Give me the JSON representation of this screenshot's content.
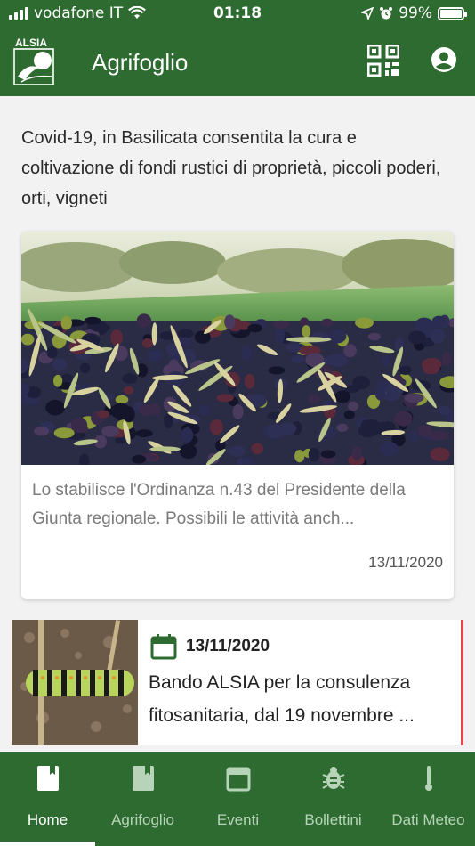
{
  "status_bar": {
    "carrier": "vodafone IT",
    "time": "01:18",
    "battery": "99%",
    "battery_level": 0.99
  },
  "app_bar": {
    "logo_text": "ALSIA",
    "title": "Agrifoglio",
    "qr_icon": "qr-code-icon",
    "account_icon": "account-circle-icon"
  },
  "featured": {
    "headline": "Covid-19, in Basilicata consentita la cura e coltivazione di fondi rustici di proprietà, piccoli poderi, orti, vigneti",
    "excerpt": "Lo stabilisce l'Ordinanza n.43 del Presidente della Giunta regionale. Possibili le attività anch...",
    "date": "13/11/2020"
  },
  "event": {
    "date": "13/11/2020",
    "title": "Bando ALSIA per la consulenza fitosanitaria, dal 19 novembre ...",
    "accent_color": "#e04a4a"
  },
  "tabs": [
    {
      "label": "Home",
      "icon": "book-icon",
      "active": true
    },
    {
      "label": "Agrifoglio",
      "icon": "book-icon",
      "active": false
    },
    {
      "label": "Eventi",
      "icon": "calendar-icon",
      "active": false
    },
    {
      "label": "Bollettini",
      "icon": "bug-icon",
      "active": false
    },
    {
      "label": "Dati Meteo",
      "icon": "thermometer-icon",
      "active": false
    }
  ],
  "colors": {
    "primary": "#2e6b30",
    "tab_inactive": "#b8d4b8",
    "tab_active": "#ffffff"
  }
}
